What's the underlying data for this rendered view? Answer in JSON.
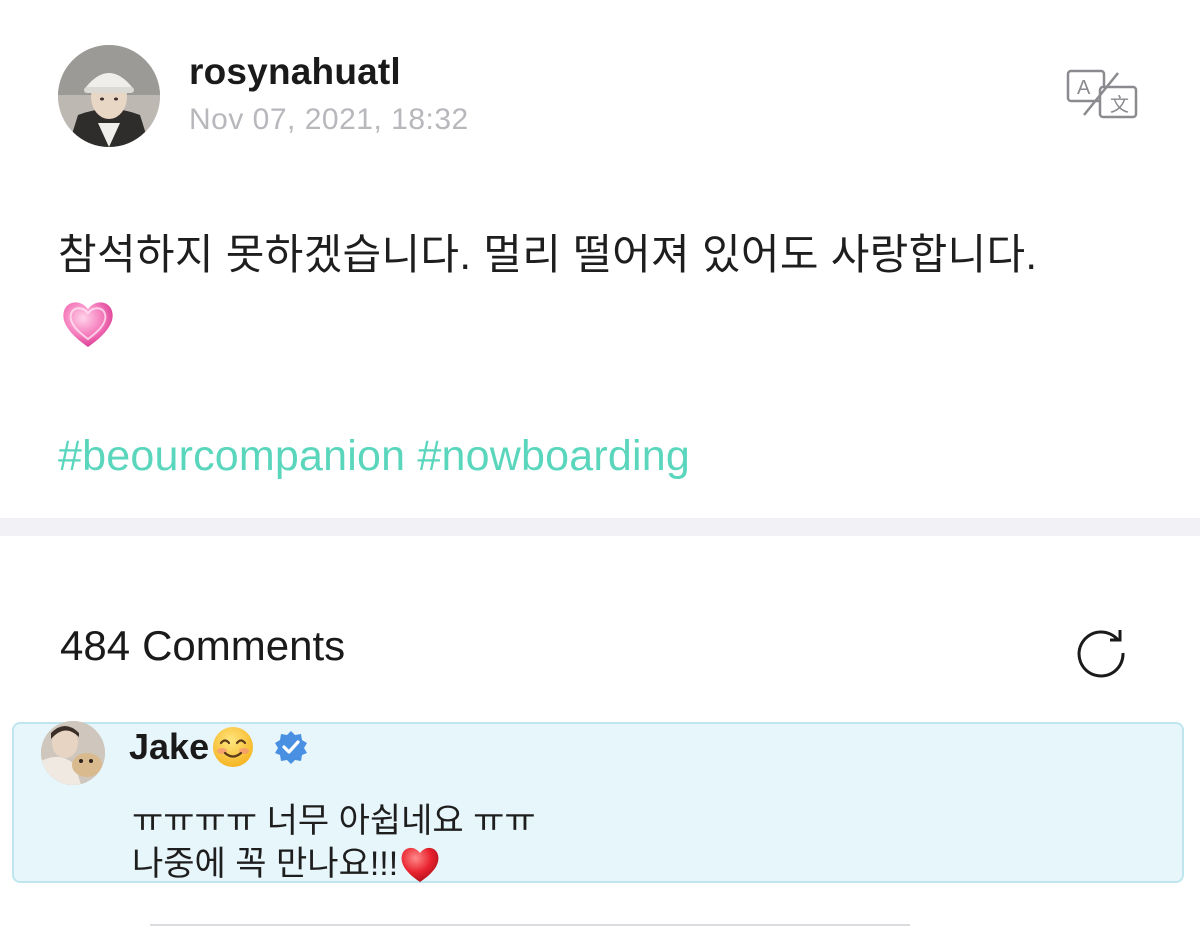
{
  "post": {
    "author": "rosynahuatl",
    "timestamp": "Nov 07, 2021, 18:32",
    "text": "참석하지 못하겠습니다. 멀리 떨어져 있어도 사랑합니다.",
    "emoji": "pink-heart",
    "hashtags": [
      "#beourcompanion",
      "#nowboarding"
    ],
    "translate_icon": "translate-icon"
  },
  "comments": {
    "count": "484",
    "label": "Comments",
    "refresh_icon": "refresh-icon",
    "highlighted": {
      "author": "Jake",
      "author_emoji": "smiling-face",
      "verified": true,
      "lines": [
        "ㅠㅠㅠㅠ 너무 아쉽네요 ㅠㅠ",
        "나중에 꼭 만나요!!!"
      ],
      "end_emoji": "red-heart",
      "card_color": "#e7f6fb"
    }
  },
  "colors": {
    "hashtag": "#5ad6bd",
    "timestamp": "#b7b7bc",
    "verified": "#4a90e2"
  }
}
